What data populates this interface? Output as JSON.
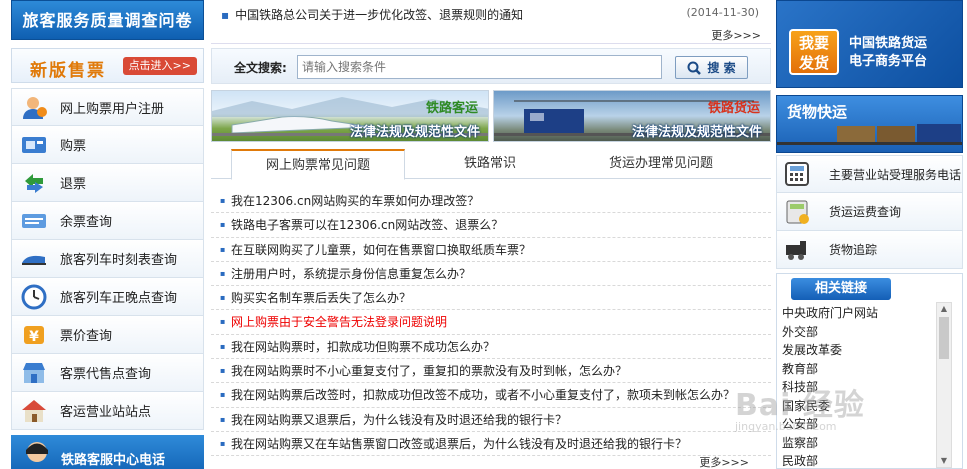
{
  "left": {
    "survey_button": "旅客服务质量调查问卷",
    "new_version": {
      "title": "新版售票",
      "enter": "点击进入>>"
    },
    "menu": [
      {
        "label": "网上购票用户注册",
        "icon": "user-register-icon"
      },
      {
        "label": "购票",
        "icon": "ticket-icon"
      },
      {
        "label": "退票",
        "icon": "refund-icon"
      },
      {
        "label": "余票查询",
        "icon": "remaining-tickets-icon"
      },
      {
        "label": "旅客列车时刻表查询",
        "icon": "timetable-icon"
      },
      {
        "label": "旅客列车正晚点查询",
        "icon": "clock-icon"
      },
      {
        "label": "票价查询",
        "icon": "price-icon"
      },
      {
        "label": "客票代售点查询",
        "icon": "agency-shop-icon"
      },
      {
        "label": "客运营业站站点",
        "icon": "station-icon"
      }
    ],
    "hotline": "铁路客服中心电话"
  },
  "notice": {
    "title": "中国铁路总公司关于进一步优化改签、退票规则的通知",
    "date": "(2014-11-30)",
    "more": "更多>>>"
  },
  "search": {
    "label": "全文搜索:",
    "placeholder": "请输入搜索条件",
    "button": "搜  索"
  },
  "banners": [
    {
      "top": "铁路客运",
      "bottom": "法律法规及规范性文件"
    },
    {
      "top": "铁路货运",
      "bottom": "法律法规及规范性文件"
    }
  ],
  "tabs": [
    "网上购票常见问题",
    "铁路常识",
    "货运办理常见问题"
  ],
  "faq": [
    {
      "text": "我在12306.cn网站购买的车票如何办理改签？",
      "highlight": false
    },
    {
      "text": "铁路电子客票可以在12306.cn网站改签、退票么？",
      "highlight": false
    },
    {
      "text": "在互联网购买了儿童票，如何在售票窗口换取纸质车票？",
      "highlight": false
    },
    {
      "text": "注册用户时，系统提示身份信息重复怎么办？",
      "highlight": false
    },
    {
      "text": "购买实名制车票后丢失了怎么办？",
      "highlight": false
    },
    {
      "text": "网上购票由于安全警告无法登录问题说明",
      "highlight": true
    },
    {
      "text": "我在网站购票时，扣款成功但购票不成功怎么办？",
      "highlight": false
    },
    {
      "text": "我在网站购票时不小心重复支付了，重复扣的票款没有及时到帐，怎么办？",
      "highlight": false
    },
    {
      "text": "我在网站购票后改签时，扣款成功但改签不成功，或者不小心重复支付了，款项未到帐怎么办？",
      "highlight": false
    },
    {
      "text": "我在网站购票又退票后，为什么钱没有及时退还给我的银行卡？",
      "highlight": false
    },
    {
      "text": "我在网站购票又在车站售票窗口改签或退票后，为什么钱没有及时退还给我的银行卡？",
      "highlight": false
    }
  ],
  "faq_more": "更多>>>",
  "right": {
    "freight": {
      "badge": "我要\n发货",
      "line1": "中国铁路货运",
      "line2": "电子商务平台"
    },
    "express": "货物快运",
    "menu": [
      {
        "label": "主要营业站受理服务电话",
        "icon": "phone-icon"
      },
      {
        "label": "货运运费查询",
        "icon": "calculator-icon"
      },
      {
        "label": "货物追踪",
        "icon": "locomotive-icon"
      }
    ],
    "links": {
      "header": "相关链接",
      "items": [
        "中央政府门户网站",
        "外交部",
        "发展改革委",
        "教育部",
        "科技部",
        "国家民委",
        "公安部",
        "监察部",
        "民政部"
      ]
    }
  },
  "watermark": {
    "main": "Bai 经验",
    "sub": "jingyan.baidu.com"
  }
}
